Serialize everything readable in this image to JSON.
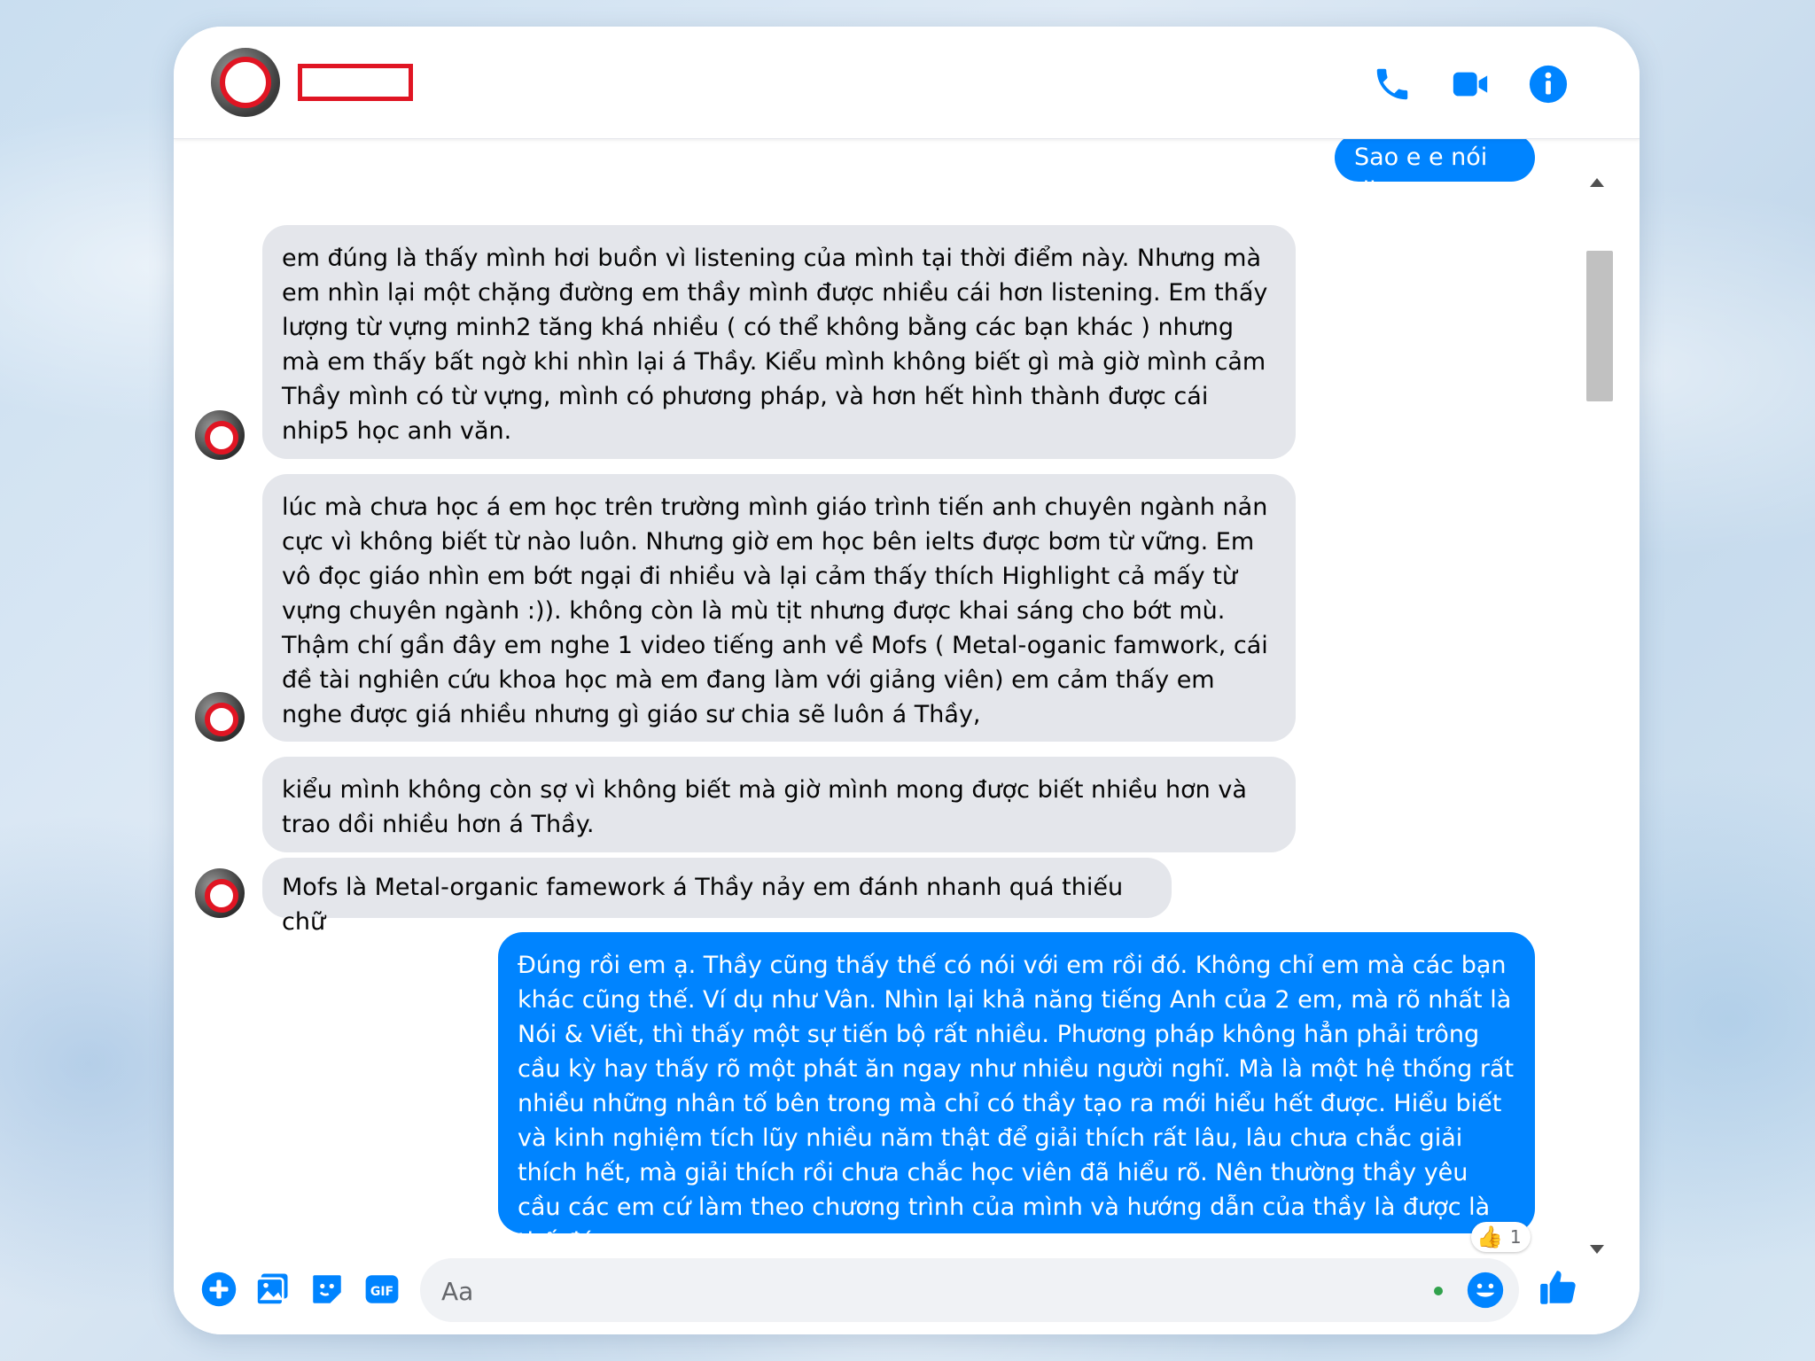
{
  "header": {
    "contact_name": "",
    "call_icon": "phone-icon",
    "video_icon": "video-camera-icon",
    "info_icon": "info-icon"
  },
  "messages": [
    {
      "direction": "outgoing",
      "text": "Sao e e nói đi"
    },
    {
      "direction": "incoming",
      "text": "em đúng là thấy mình hơi buồn vì listening của mình tại thời điểm này. Nhưng mà em nhìn lại một chặng đường em thầy mình được nhiều cái hơn listening. Em thấy lượng từ vựng minh2 tăng khá nhiều ( có thể không bằng các bạn khác ) nhưng mà em thấy bất ngờ khi nhìn lại á Thầy. Kiểu mình không biết gì mà giờ mình cảm Thầy mình có từ vựng, mình có phương pháp, và hơn hết hình thành được cái nhip5 học anh văn."
    },
    {
      "direction": "incoming",
      "text": "lúc mà chưa học á em học trên trường mình giáo trình tiến anh chuyên ngành nản cực vì không biết từ nào luôn. Nhưng giờ em học bên ielts được bơm từ vững. Em vô đọc giáo nhìn em bớt ngại đi nhiều và lại cảm thấy thích Highlight cả mấy từ vựng chuyên ngành :)). không còn là mù tịt nhưng được khai sáng cho bớt mù. Thậm chí gần đây em nghe 1 video tiếng anh về Mofs ( Metal-oganic famwork, cái đề tài nghiên cứu khoa học mà em đang làm với giảng viên) em cảm thấy em nghe được giá nhiều nhưng gì giáo sư chia sẽ luôn á Thầy,"
    },
    {
      "direction": "incoming",
      "text": "kiểu mình không còn sợ vì không biết mà giờ mình mong được biết nhiều hơn và trao dồi nhiều hơn á Thầy."
    },
    {
      "direction": "incoming",
      "text": "Mofs là Metal-organic famework á Thầy nảy em đánh nhanh quá thiếu chữ"
    },
    {
      "direction": "outgoing",
      "text": "Đúng rồi em ạ. Thầy cũng thấy thế có nói với em rồi đó. Không chỉ em mà các bạn khác cũng thế. Ví dụ như Vân. Nhìn lại khả năng tiếng Anh của 2 em, mà rõ nhất là Nói & Viết, thì thấy một sự tiến bộ rất nhiều. Phương pháp không hẳn phải trông cầu kỳ hay thấy rõ một phát ăn ngay như nhiều người nghĩ. Mà là một hệ thống rất nhiều những nhân tố bên trong mà chỉ có thầy tạo ra mới hiểu hết được. Hiểu biết và kinh nghiệm tích lũy nhiều năm thật để giải thích rất lâu, lâu chưa chắc giải thích hết, mà giải thích rồi chưa chắc học viên đã hiểu rõ. Nên thường thầy yêu cầu các em cứ làm theo chương trình của mình và hướng dẫn của thầy là được là thế đó em."
    }
  ],
  "reaction": {
    "icon": "thumbs-up-emoji",
    "count": "1"
  },
  "composer": {
    "placeholder": "Aa",
    "icons": [
      "plus-circle-icon",
      "image-icon",
      "sticker-icon",
      "gif-icon",
      "emoji-icon",
      "like-icon"
    ],
    "gif_label": "GIF"
  },
  "colors": {
    "accent": "#0084ff",
    "incoming_bubble": "#e4e6eb",
    "redaction": "#e01523"
  }
}
